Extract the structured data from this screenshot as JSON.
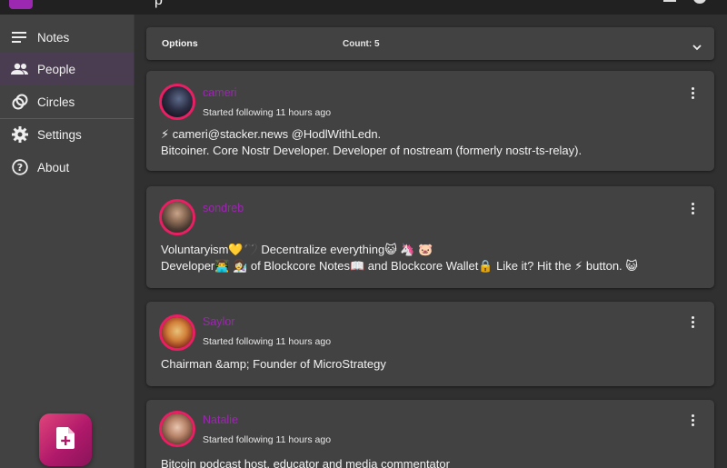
{
  "topbar": {
    "title_fragment": "p"
  },
  "sidebar": {
    "items": [
      {
        "label": "Notes",
        "icon": "notes-icon"
      },
      {
        "label": "People",
        "icon": "people-icon",
        "active": true
      },
      {
        "label": "Circles",
        "icon": "circles-icon"
      },
      {
        "label": "Settings",
        "icon": "gear-icon"
      },
      {
        "label": "About",
        "icon": "help-icon"
      }
    ],
    "fab_icon": "new-note-icon"
  },
  "options": {
    "label": "Options",
    "count": "Count: 5"
  },
  "people": [
    {
      "name": "cameri",
      "status": "Started following 11 hours ago",
      "about": "⚡ cameri@stacker.news @HodlWithLedn.\nBitcoiner. Core Nostr Developer. Developer of nostream (formerly nostr-ts-relay)."
    },
    {
      "name": "sondreb",
      "status": "",
      "about": "Voluntaryism💛🖤 Decentralize everything😺 🦄 🐷\nDeveloper👨‍💻 👩‍🔬 of Blockcore Notes📖 and Blockcore Wallet🔒 Like it? Hit the ⚡ button. 😺"
    },
    {
      "name": "Saylor",
      "status": "Started following 11 hours ago",
      "about": "Chairman &amp; Founder of MicroStrategy"
    },
    {
      "name": "Natalie",
      "status": "Started following 11 hours ago",
      "about": "Bitcoin podcast host, educator and media commentator"
    }
  ],
  "colors": {
    "accent": "#9c27b0",
    "avatar_ring": "#e91e63",
    "fab": "#c2185b"
  }
}
